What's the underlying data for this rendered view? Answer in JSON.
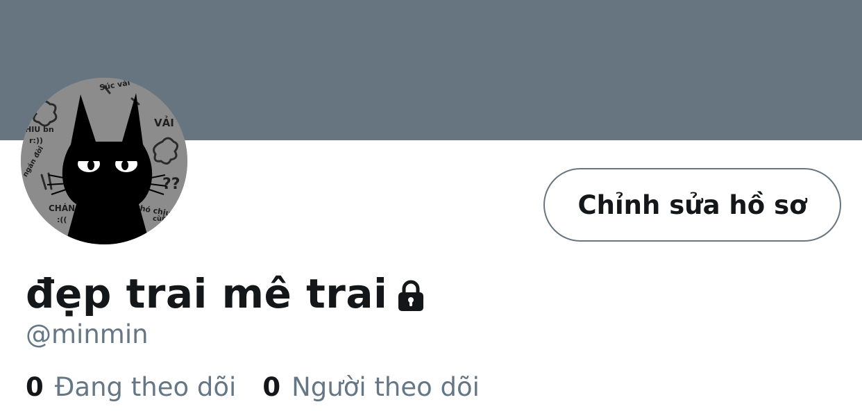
{
  "profile": {
    "display_name": "đẹp trai mê trai",
    "handle": "@minmin",
    "protected_icon": "lock-icon",
    "avatar_icon": "black-cat-avatar"
  },
  "actions": {
    "edit_profile_label": "Chỉnh sửa hồ sơ"
  },
  "stats": {
    "following_count": "0",
    "following_label": "Đang theo dõi",
    "followers_count": "0",
    "followers_label": "Người theo dõi"
  },
  "colors": {
    "banner": "#66757f",
    "text_primary": "#14171a",
    "text_secondary": "#657786",
    "button_border": "#66757f"
  }
}
